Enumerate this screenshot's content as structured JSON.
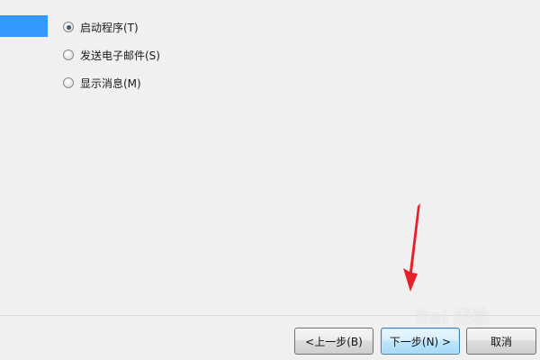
{
  "options": [
    {
      "label": "启动程序(T)",
      "checked": true
    },
    {
      "label": "发送电子邮件(S)",
      "checked": false
    },
    {
      "label": "显示消息(M)",
      "checked": false
    }
  ],
  "buttons": {
    "back": "<上一步(B)",
    "next": "下一步(N) >",
    "cancel": "取消"
  },
  "watermark": "Bai 经验",
  "colors": {
    "selection": "#3399ff",
    "arrow": "#e8202a"
  }
}
